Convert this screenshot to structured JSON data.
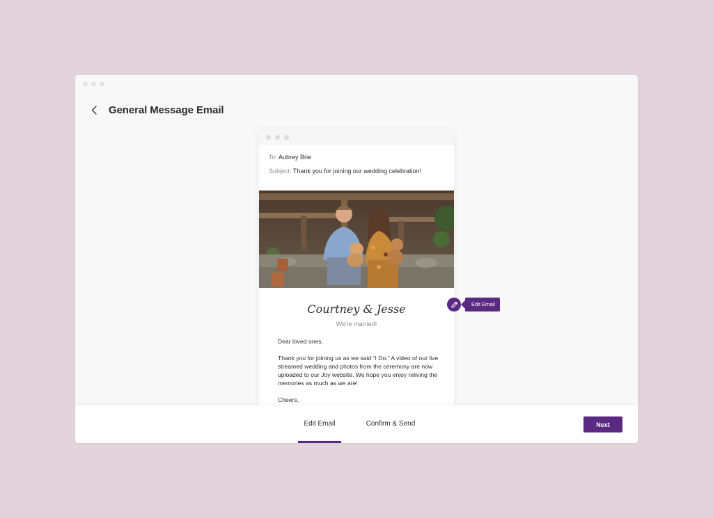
{
  "header": {
    "title": "General Message Email"
  },
  "email": {
    "to_label": "To:",
    "to_value": "Aubrey Brie",
    "subject_label": "Subject:",
    "subject_value": "Thank you for joining our wedding celebration!",
    "couple_name": "Courtney & Jesse",
    "subline": "We're married!",
    "greeting": "Dear loved ones,",
    "paragraph": "Thank you for joining us as we said “I Do.” A video of our live streamed wedding and photos from the ceremony are now uploaded to our Joy website. We hope you enjoy reliving the memories as much as we are!",
    "signoff": "Cheers,"
  },
  "edit_tooltip": {
    "label": "Edit Email"
  },
  "footer": {
    "tab_edit": "Edit Email",
    "tab_confirm": "Confirm & Send",
    "next_label": "Next"
  },
  "colors": {
    "accent": "#5a2a82",
    "background": "#e3d3da"
  }
}
